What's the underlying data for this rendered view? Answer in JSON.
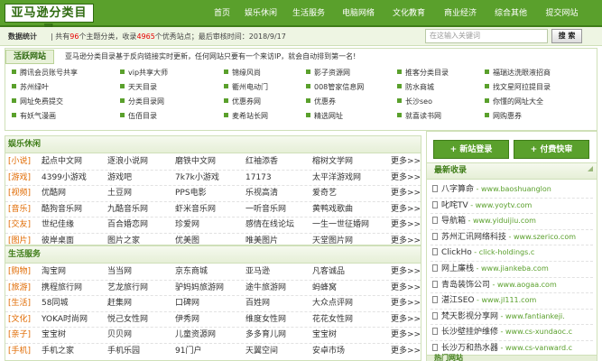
{
  "header": {
    "logo": "亚马逊分类目录",
    "nav": [
      "首页",
      "娱乐休闲",
      "生活服务",
      "电脑网络",
      "文化教育",
      "商业经济",
      "综合其他",
      "提交网站"
    ]
  },
  "stats": {
    "title": "数据统计",
    "prefix": "共有",
    "categories": "96",
    "middle1": "个主题分类，收录",
    "sites": "4965",
    "middle2": "个优秀站点；最后审核时间：2018/9/17"
  },
  "search": {
    "placeholder": "在这输入关键词",
    "button": "搜 索"
  },
  "hot": {
    "title": "活跃网站",
    "notice": "亚马逊分类目录基于反向链接实时更新，任何网站只要有一个来访IP，就会自动排到第一名!",
    "rows": [
      [
        "腾讯会员账号共享",
        "vip共享大师",
        "锦缘风尚",
        "影子资源网",
        "推客分类目录",
        "福瑞达洗眼液招商"
      ],
      [
        "苏州绿叶",
        "天天目录",
        "衢州电动门",
        "008管家信息网",
        "防水商城",
        "找文星阿拉提目录"
      ],
      [
        "网址免费提交",
        "分类目录网",
        "优惠券网",
        "优惠券",
        "长沙seo",
        "你懂的网址大全"
      ],
      [
        "有妖气漫画",
        "伍佰目录",
        "麦希站长网",
        "精选网址",
        "就喜读书网",
        "网购惠券"
      ]
    ]
  },
  "sections": [
    {
      "title": "娱乐休闲",
      "rows": [
        {
          "cat": "[小说]",
          "links": [
            "起点中文网",
            "逐浪小说网",
            "磨铁中文网",
            "红袖添香",
            "榕树文学网"
          ],
          "more": "更多>>"
        },
        {
          "cat": "[游戏]",
          "links": [
            "4399小游戏",
            "游戏吧",
            "7k7k小游戏",
            "17173",
            "太平洋游戏网"
          ],
          "more": "更多>>"
        },
        {
          "cat": "[视频]",
          "links": [
            "优酷网",
            "土豆网",
            "PPS电影",
            "乐视高清",
            "爱奇艺"
          ],
          "more": "更多>>"
        },
        {
          "cat": "[音乐]",
          "links": [
            "酷狗音乐网",
            "九酷音乐网",
            "虾米音乐网",
            "一听音乐网",
            "黄鸭戏歌曲"
          ],
          "more": "更多>>"
        },
        {
          "cat": "[交友]",
          "links": [
            "世纪佳缘",
            "百合婚恋网",
            "珍爱网",
            "感情在线论坛",
            "一生一世征婚网"
          ],
          "more": "更多>>"
        },
        {
          "cat": "[图片]",
          "links": [
            "彼岸桌面",
            "图片之家",
            "优美图",
            "唯美图片",
            "天堂图片网"
          ],
          "more": "更多>>"
        }
      ]
    },
    {
      "title": "生活服务",
      "rows": [
        {
          "cat": "[购物]",
          "links": [
            "淘宝网",
            "当当网",
            "京东商城",
            "亚马逊",
            "凡客诚品"
          ],
          "more": "更多>>"
        },
        {
          "cat": "[旅游]",
          "links": [
            "携程旅行网",
            "艺龙旅行网",
            "驴妈妈旅游网",
            "途牛旅游网",
            "蚂蜂窝"
          ],
          "more": "更多>>"
        },
        {
          "cat": "[生活]",
          "links": [
            "58同城",
            "赶集网",
            "口碑网",
            "百姓网",
            "大众点评网"
          ],
          "more": "更多>>"
        },
        {
          "cat": "[文化]",
          "links": [
            "YOKA时尚网",
            "悦己女性网",
            "伊秀网",
            "维度女性网",
            "花花女性网"
          ],
          "more": "更多>>"
        },
        {
          "cat": "[亲子]",
          "links": [
            "宝宝树",
            "贝贝网",
            "儿童资源网",
            "多多育儿网",
            "宝宝树"
          ],
          "more": "更多>>"
        },
        {
          "cat": "[手机]",
          "links": [
            "手机之家",
            "手机乐园",
            "91门户",
            "天翼空间",
            "安卓市场"
          ],
          "more": "更多>>"
        }
      ]
    }
  ],
  "sidebar": {
    "login_button": "+ 新站登录",
    "paid_button": "+ 付费快审",
    "recent_title": "最新收录",
    "recent": [
      {
        "name": "八字算命",
        "url": "www.baoshuanglon"
      },
      {
        "name": "叱咤TV",
        "url": "www.yoytv.com"
      },
      {
        "name": "导航箱",
        "url": "www.yiduijiu.com"
      },
      {
        "name": "苏州汇讯网络科技",
        "url": "www.szerico.com"
      },
      {
        "name": "ClickHo",
        "url": "click-holdings.c"
      },
      {
        "name": "网上廉栈",
        "url": "www.jiankeba.com"
      },
      {
        "name": "青岛装饰公司",
        "url": "www.aogaa.com"
      },
      {
        "name": "湛江SEO",
        "url": "www.jl111.com"
      },
      {
        "name": "梵天影视分享网",
        "url": "www.fantiankeji."
      },
      {
        "name": "长沙壁挂炉维修",
        "url": "www.cs-xundaoc.c"
      },
      {
        "name": "长沙万和热水器",
        "url": "www.cs-vanward.c"
      }
    ],
    "bottom_title": "热门网站"
  }
}
